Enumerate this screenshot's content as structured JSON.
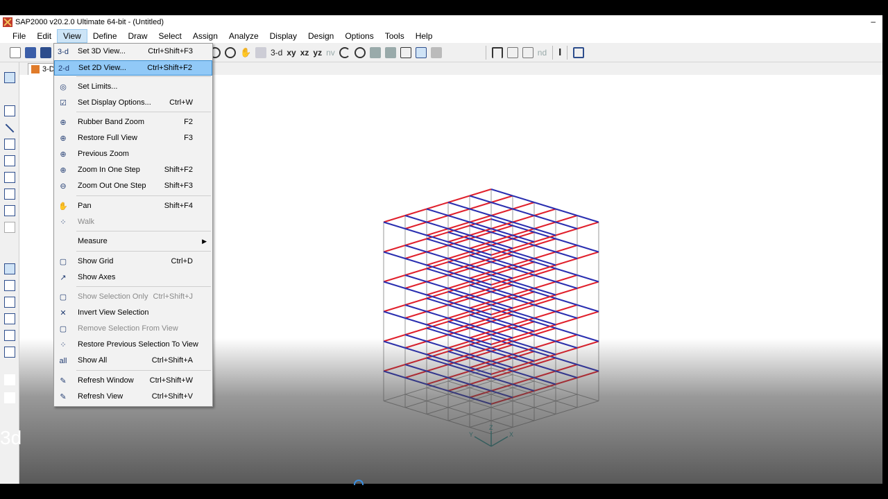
{
  "window": {
    "title": "SAP2000 v20.2.0 Ultimate 64-bit - (Untitled)",
    "minimize": "–"
  },
  "menubar": [
    "File",
    "Edit",
    "View",
    "Define",
    "Draw",
    "Select",
    "Assign",
    "Analyze",
    "Display",
    "Design",
    "Options",
    "Tools",
    "Help"
  ],
  "toolbar": {
    "view_3d": "3-d",
    "view_xy": "xy",
    "view_xz": "xz",
    "view_yz": "yz",
    "view_nv": "nv",
    "nd": "nd",
    "text_icon": "I"
  },
  "tab": {
    "label": "3-D"
  },
  "view_menu": {
    "items": [
      {
        "icon": "3-d",
        "label": "Set 3D View...",
        "shortcut": "Ctrl+Shift+F3"
      },
      {
        "icon": "2-d",
        "label": "Set 2D View...",
        "shortcut": "Ctrl+Shift+F2"
      },
      {
        "icon": "◎",
        "label": "Set Limits...",
        "shortcut": ""
      },
      {
        "icon": "☑",
        "label": "Set Display Options...",
        "shortcut": "Ctrl+W"
      },
      {
        "icon": "⊕",
        "label": "Rubber Band Zoom",
        "shortcut": "F2"
      },
      {
        "icon": "⊕",
        "label": "Restore Full View",
        "shortcut": "F3"
      },
      {
        "icon": "⊕",
        "label": "Previous Zoom",
        "shortcut": ""
      },
      {
        "icon": "⊕",
        "label": "Zoom In One Step",
        "shortcut": "Shift+F2"
      },
      {
        "icon": "⊖",
        "label": "Zoom Out One Step",
        "shortcut": "Shift+F3"
      },
      {
        "icon": "✋",
        "label": "Pan",
        "shortcut": "Shift+F4"
      },
      {
        "icon": "⁘",
        "label": "Walk",
        "shortcut": ""
      },
      {
        "icon": "",
        "label": "Measure",
        "shortcut": ""
      },
      {
        "icon": "▢",
        "label": "Show Grid",
        "shortcut": "Ctrl+D"
      },
      {
        "icon": "↗",
        "label": "Show Axes",
        "shortcut": ""
      },
      {
        "icon": "▢",
        "label": "Show Selection Only",
        "shortcut": "Ctrl+Shift+J"
      },
      {
        "icon": "✕",
        "label": "Invert View Selection",
        "shortcut": ""
      },
      {
        "icon": "▢",
        "label": "Remove Selection From View",
        "shortcut": ""
      },
      {
        "icon": "⁘",
        "label": "Restore Previous Selection To View",
        "shortcut": ""
      },
      {
        "icon": "all",
        "label": "Show All",
        "shortcut": "Ctrl+Shift+A"
      },
      {
        "icon": "✎",
        "label": "Refresh Window",
        "shortcut": "Ctrl+Shift+W"
      },
      {
        "icon": "✎",
        "label": "Refresh View",
        "shortcut": "Ctrl+Shift+V"
      }
    ]
  },
  "axes": {
    "x": "X",
    "y": "Y",
    "z": "Z"
  },
  "caption": "3d",
  "colors": {
    "accent_blue": "#2a2fb0",
    "accent_red": "#e0202c",
    "grid": "#9a9a9a",
    "menu_highlight": "#91c9f7"
  }
}
